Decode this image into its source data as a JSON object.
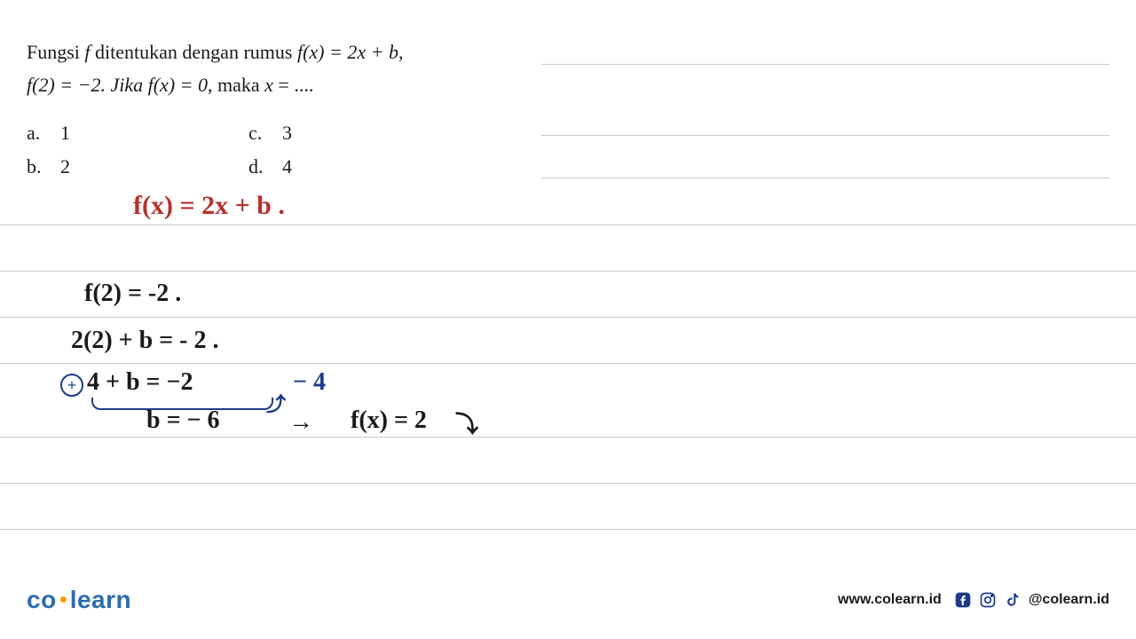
{
  "problem": {
    "line1_pre": "Fungsi ",
    "line1_f": "f",
    "line1_mid": " ditentukan dengan rumus ",
    "line1_fx": "f(x) = 2x + b",
    "line1_comma": ",",
    "line2_a": "f(2) = −2. Jika ",
    "line2_fx": "f(x) = 0",
    "line2_b": ", maka ",
    "line2_x": "x",
    "line2_c": " = ...."
  },
  "options": {
    "a": {
      "label": "a.",
      "value": "1"
    },
    "b": {
      "label": "b.",
      "value": "2"
    },
    "c": {
      "label": "c.",
      "value": "3"
    },
    "d": {
      "label": "d.",
      "value": "4"
    }
  },
  "handwriting": {
    "s1": "f(x) = 2x + b .",
    "s2": "f(2) = -2 .",
    "s3": "2(2) + b  =  - 2 .",
    "s4_lhs": "4  + b  =  −2 ",
    "s4_rhs": "− 4",
    "s5": "b  =  − 6",
    "arrow": "→",
    "s6": "f(x) = 2",
    "s6_tail": "⤵",
    "plus_circle": "+"
  },
  "footer": {
    "brand_left": "co",
    "brand_right": "learn",
    "url": "www.colearn.id",
    "handle": "@colearn.id"
  }
}
